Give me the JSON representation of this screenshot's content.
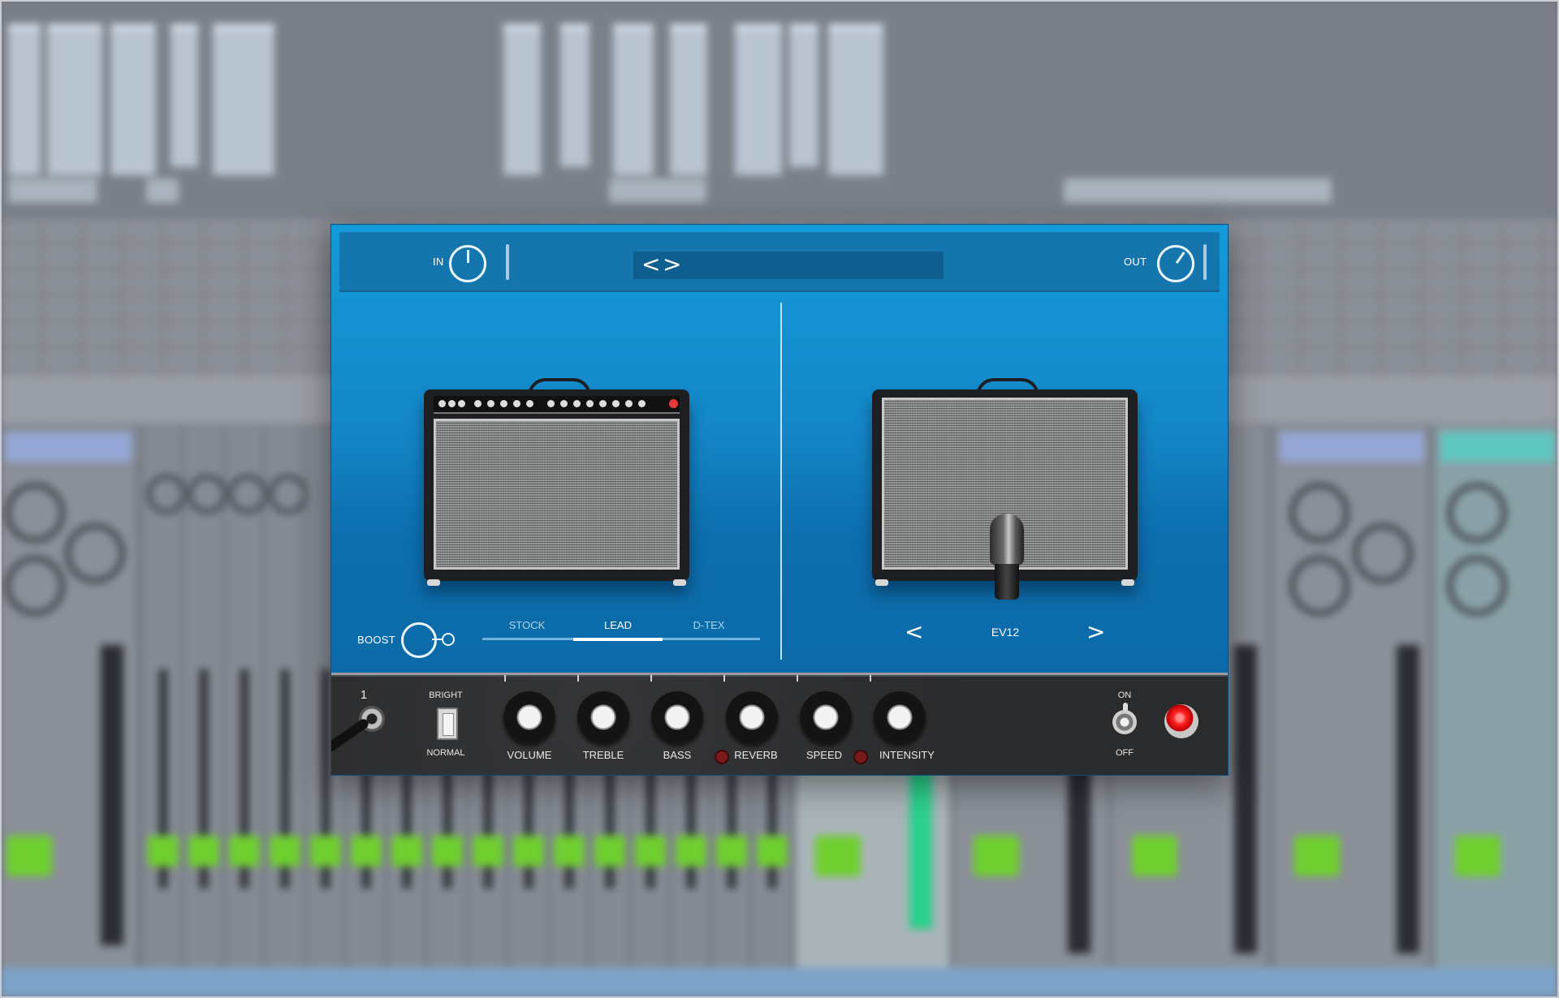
{
  "plugin": {
    "in_label": "IN",
    "out_label": "OUT",
    "preset_prev": "<",
    "preset_next": ">",
    "boost_label": "BOOST",
    "tabs": [
      {
        "label": "STOCK",
        "active": false
      },
      {
        "label": "LEAD",
        "active": true
      },
      {
        "label": "D-TEX",
        "active": false
      }
    ],
    "mic": {
      "prev": "<",
      "name": "EV12",
      "next": ">"
    }
  },
  "panel": {
    "input_number": "1",
    "bright_top": "BRIGHT",
    "bright_bottom": "NORMAL",
    "knobs": [
      {
        "label": "VOLUME"
      },
      {
        "label": "TREBLE"
      },
      {
        "label": "BASS"
      },
      {
        "label": "REVERB"
      },
      {
        "label": "SPEED"
      },
      {
        "label": "INTENSITY"
      }
    ],
    "on_label": "ON",
    "off_label": "OFF"
  },
  "colors": {
    "accent": "#139ad8",
    "power_led": "#ff2222",
    "track_number": "#6fcf2f"
  }
}
